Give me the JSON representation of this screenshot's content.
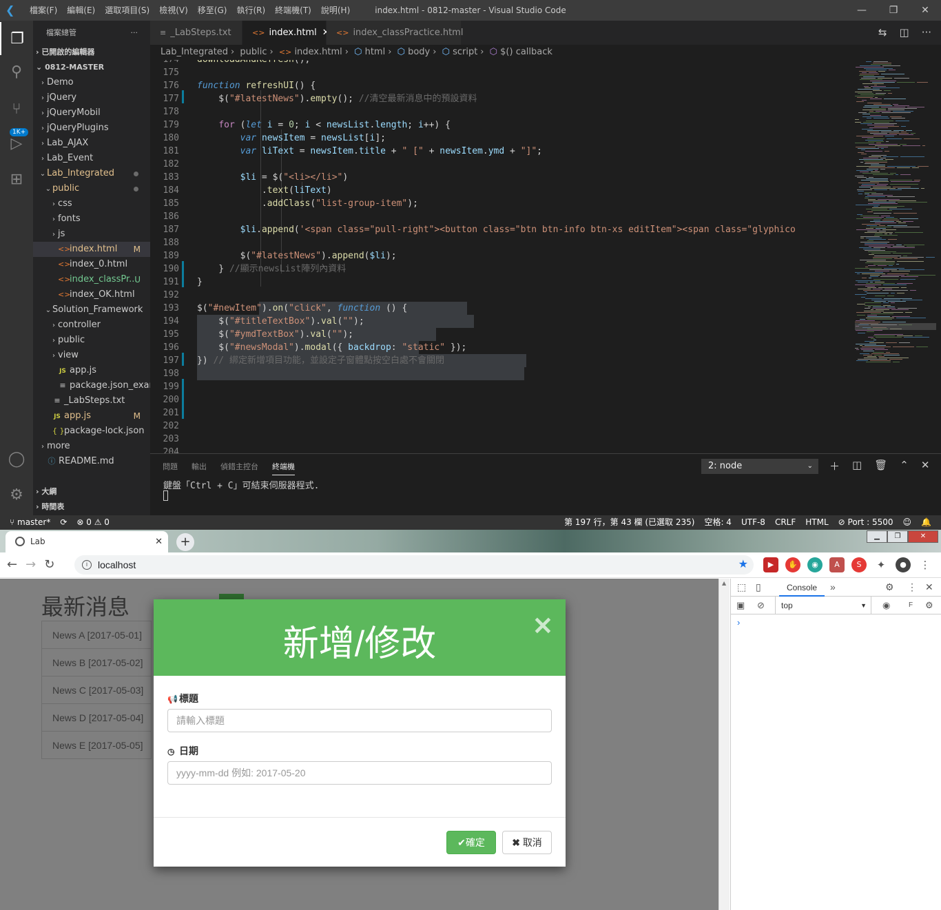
{
  "vscode": {
    "menu": [
      "檔案(F)",
      "編輯(E)",
      "選取項目(S)",
      "檢視(V)",
      "移至(G)",
      "執行(R)",
      "終端機(T)",
      "說明(H)"
    ],
    "window_title": "index.html - 0812-master - Visual Studio Code",
    "activity_badge": "1K+",
    "explorer": {
      "title": "檔案總管",
      "open_editors": "已開啟的編輯器",
      "workspace": "0812-MASTER",
      "tree": [
        {
          "label": "Demo",
          "type": "folder",
          "depth": 1,
          "open": false
        },
        {
          "label": "jQuery",
          "type": "folder",
          "depth": 1,
          "open": false
        },
        {
          "label": "jQueryMobil",
          "type": "folder",
          "depth": 1,
          "open": false
        },
        {
          "label": "jQueryPlugins",
          "type": "folder",
          "depth": 1,
          "open": false
        },
        {
          "label": "Lab_AJAX",
          "type": "folder",
          "depth": 1,
          "open": false
        },
        {
          "label": "Lab_Event",
          "type": "folder",
          "depth": 1,
          "open": false
        },
        {
          "label": "Lab_Integrated",
          "type": "folder",
          "depth": 1,
          "open": true,
          "status": "dot",
          "color": "mod"
        },
        {
          "label": "public",
          "type": "folder",
          "depth": 2,
          "open": true,
          "status": "dot",
          "color": "mod"
        },
        {
          "label": "css",
          "type": "folder",
          "depth": 3,
          "open": false
        },
        {
          "label": "fonts",
          "type": "folder",
          "depth": 3,
          "open": false
        },
        {
          "label": "js",
          "type": "folder",
          "depth": 3,
          "open": false
        },
        {
          "label": "index.html",
          "type": "html",
          "depth": 3,
          "status": "M",
          "color": "mod",
          "selected": true
        },
        {
          "label": "index_0.html",
          "type": "html",
          "depth": 3
        },
        {
          "label": "index_classPr...",
          "type": "html",
          "depth": 3,
          "status": "U",
          "color": "unt"
        },
        {
          "label": "index_OK.html",
          "type": "html",
          "depth": 3
        },
        {
          "label": "Solution_Framework",
          "type": "folder",
          "depth": 2,
          "open": true
        },
        {
          "label": "controller",
          "type": "folder",
          "depth": 3,
          "open": false
        },
        {
          "label": "public",
          "type": "folder",
          "depth": 3,
          "open": false
        },
        {
          "label": "view",
          "type": "folder",
          "depth": 3,
          "open": false
        },
        {
          "label": "app.js",
          "type": "js",
          "depth": 3
        },
        {
          "label": "package.json_exam...",
          "type": "txt",
          "depth": 3
        },
        {
          "label": "_LabSteps.txt",
          "type": "txt",
          "depth": 2
        },
        {
          "label": "app.js",
          "type": "js",
          "depth": 2,
          "status": "M",
          "color": "mod"
        },
        {
          "label": "package-lock.json",
          "type": "json",
          "depth": 2
        },
        {
          "label": "more",
          "type": "folder",
          "depth": 1,
          "open": false
        },
        {
          "label": "README.md",
          "type": "info",
          "depth": 1
        }
      ],
      "outline": "大綱",
      "timeline": "時間表"
    },
    "tabs": [
      {
        "label": "_LabSteps.txt",
        "icon": "≡",
        "active": false
      },
      {
        "label": "index.html",
        "icon": "<>",
        "active": true
      },
      {
        "label": "index_classPractice.html",
        "icon": "<>",
        "active": false
      }
    ],
    "breadcrumb": [
      "Lab_Integrated",
      "public",
      "index.html",
      "html",
      "body",
      "script",
      "$() callback"
    ],
    "editor": {
      "line_numbers": [
        "174",
        "175",
        "176",
        "177",
        "178",
        "179",
        "180",
        "181",
        "182",
        "183",
        "184",
        "185",
        "186",
        "187",
        "188",
        "189",
        "190",
        "191",
        "192",
        "193",
        "194",
        "195",
        "196",
        "197",
        "198",
        "199",
        "200",
        "201",
        "202",
        "203",
        "204"
      ]
    },
    "panel": {
      "tabs": [
        "問題",
        "輸出",
        "偵錯主控台",
        "終端機"
      ],
      "terminal_select": "2: node",
      "terminal_text": "鍵盤「Ctrl + C」可結束伺服器程式."
    },
    "status": {
      "branch": "master*",
      "problems": "⊗ 0 ⚠ 0",
      "position": "第 197 行，第 43 欄 (已選取 235)",
      "spaces": "空格: 4",
      "encoding": "UTF-8",
      "eol": "CRLF",
      "language": "HTML",
      "port": "⊘ Port : 5500"
    }
  },
  "browser": {
    "tab_title": "Lab",
    "url": "localhost",
    "page": {
      "heading": "最新消息",
      "news": [
        "News A [2017-05-01]",
        "News B [2017-05-02]",
        "News C [2017-05-03]",
        "News D [2017-05-04]",
        "News E [2017-05-05]"
      ]
    },
    "modal": {
      "title": "新增/修改",
      "title_label": "標題",
      "title_placeholder": "請輸入標題",
      "date_label": "日期",
      "date_placeholder": "yyyy-mm-dd 例如: 2017-05-20",
      "ok": "確定",
      "cancel": "取消"
    },
    "devtools": {
      "tab": "Console",
      "context": "top"
    }
  }
}
